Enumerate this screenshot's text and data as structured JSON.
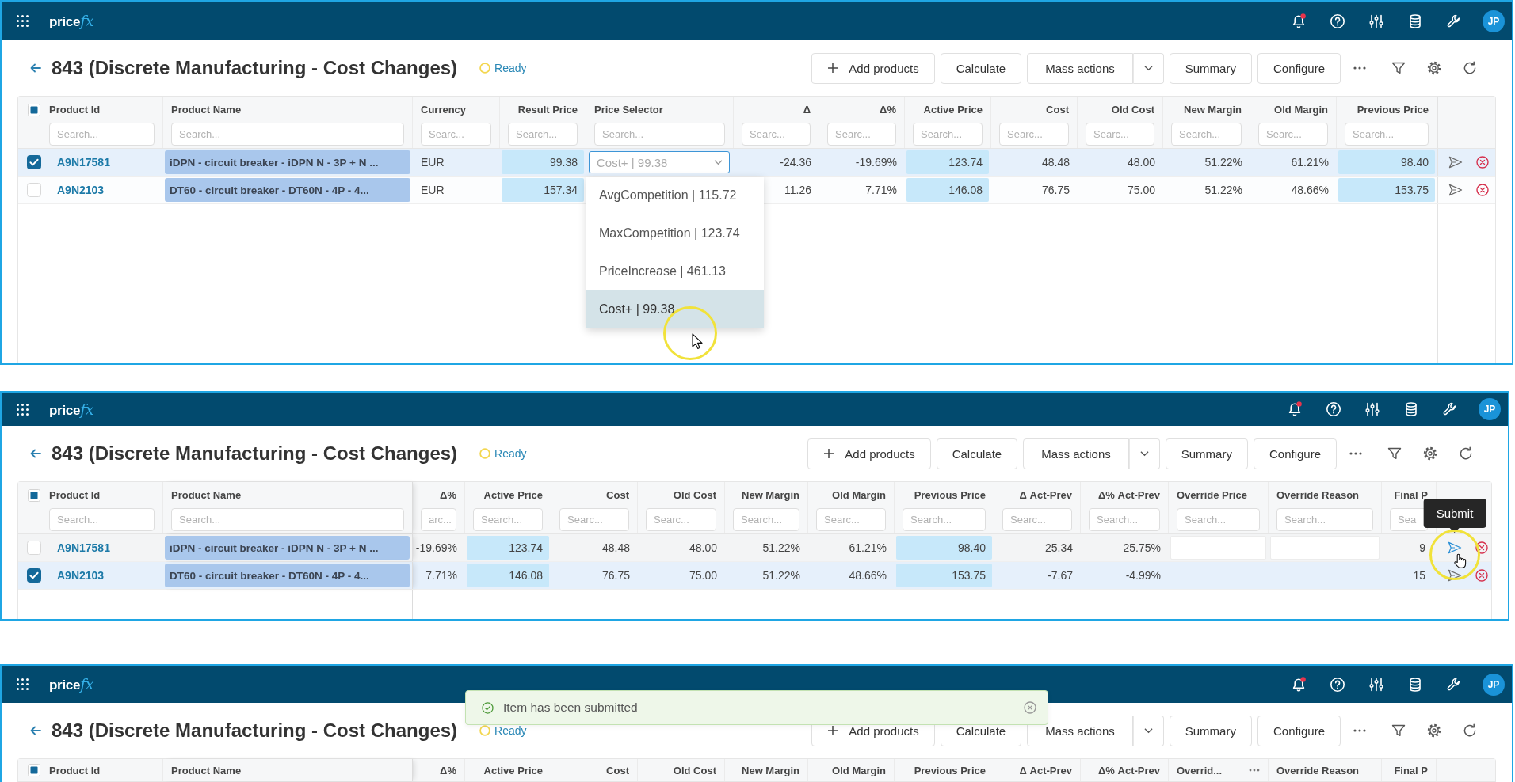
{
  "frames": [
    {
      "app_bar": {
        "logo": "price",
        "logo_accent": "fx",
        "notification": true,
        "avatar": "JP"
      },
      "page": {
        "title": "843 (Discrete Manufacturing - Cost Changes)",
        "status": "Ready"
      },
      "toolbar": {
        "buttons": [
          {
            "label": "Add products",
            "kind": "add"
          },
          {
            "label": "Calculate",
            "kind": "plain"
          },
          {
            "label": "Mass actions",
            "kind": "split"
          },
          {
            "label": "Summary",
            "kind": "plain"
          },
          {
            "label": "Configure",
            "kind": "plain"
          }
        ]
      },
      "table": {
        "header_checkbox": {
          "partial": true
        },
        "columns": [
          {
            "label": "Product Id",
            "placeholder": "Search...",
            "kind": "link"
          },
          {
            "label": "Product Name",
            "placeholder": "Search...",
            "kind": "name"
          },
          {
            "label": "Currency",
            "placeholder": "Searc...",
            "kind": "text"
          },
          {
            "label": "Result Price",
            "placeholder": "Search...",
            "kind": "highlight"
          },
          {
            "label": "Price Selector",
            "placeholder": "Search...",
            "kind": "selector"
          },
          {
            "label": "Δ",
            "placeholder": "Searc...",
            "kind": "number"
          },
          {
            "label": "Δ%",
            "placeholder": "Searc...",
            "kind": "number"
          },
          {
            "label": "Active Price",
            "placeholder": "Search...",
            "kind": "highlight"
          },
          {
            "label": "Cost",
            "placeholder": "Searc...",
            "kind": "number"
          },
          {
            "label": "Old Cost",
            "placeholder": "Searc...",
            "kind": "number"
          },
          {
            "label": "New Margin",
            "placeholder": "Search...",
            "kind": "number"
          },
          {
            "label": "Old Margin",
            "placeholder": "Searc...",
            "kind": "number"
          },
          {
            "label": "Previous Price",
            "placeholder": "Search...",
            "kind": "highlight"
          }
        ],
        "rows": [
          {
            "selected": true,
            "hovered": false,
            "cells": [
              "A9N17581",
              "iDPN - circuit breaker - iDPN N - 3P + N ...",
              "EUR",
              "99.38",
              {
                "placeholder": "Cost+ | 99.38",
                "open": true,
                "options": [
                  {
                    "label": "AvgCompetition | 115.72",
                    "selected": false
                  },
                  {
                    "label": "MaxCompetition | 123.74",
                    "selected": false
                  },
                  {
                    "label": "PriceIncrease | 461.13",
                    "selected": false
                  },
                  {
                    "label": "Cost+ | 99.38",
                    "selected": true
                  }
                ]
              },
              "-24.36",
              "-19.69%",
              "123.74",
              "48.48",
              "48.00",
              "51.22%",
              "61.21%",
              "98.40"
            ]
          },
          {
            "selected": false,
            "hovered": false,
            "cells": [
              "A9N2103",
              "DT60 - circuit breaker - DT60N - 4P - 4...",
              "EUR",
              "157.34",
              null,
              "11.26",
              "7.71%",
              "146.08",
              "76.75",
              "75.00",
              "51.22%",
              "48.66%",
              "153.75"
            ]
          }
        ]
      }
    },
    {
      "app_bar": {
        "logo": "price",
        "logo_accent": "fx",
        "notification": true,
        "avatar": "JP"
      },
      "page": {
        "title": "843 (Discrete Manufacturing - Cost Changes)",
        "status": "Ready"
      },
      "toolbar": {
        "buttons": [
          {
            "label": "Add products",
            "kind": "add"
          },
          {
            "label": "Calculate",
            "kind": "plain"
          },
          {
            "label": "Mass actions",
            "kind": "split"
          },
          {
            "label": "Summary",
            "kind": "plain"
          },
          {
            "label": "Configure",
            "kind": "plain"
          }
        ]
      },
      "table": {
        "header_checkbox": {
          "partial": true
        },
        "scrolled": true,
        "columns": [
          {
            "label": "Product Id",
            "placeholder": "Search...",
            "kind": "link"
          },
          {
            "label": "Product Name",
            "placeholder": "Search...",
            "kind": "name"
          },
          {
            "label": "Δ%",
            "placeholder": "arc...",
            "kind": "number"
          },
          {
            "label": "Active Price",
            "placeholder": "Search...",
            "kind": "highlight"
          },
          {
            "label": "Cost",
            "placeholder": "Searc...",
            "kind": "number"
          },
          {
            "label": "Old Cost",
            "placeholder": "Searc...",
            "kind": "number"
          },
          {
            "label": "New Margin",
            "placeholder": "Search...",
            "kind": "number"
          },
          {
            "label": "Old Margin",
            "placeholder": "Searc...",
            "kind": "number"
          },
          {
            "label": "Previous Price",
            "placeholder": "Search...",
            "kind": "highlight"
          },
          {
            "label": "Δ Act-Prev",
            "placeholder": "Searc...",
            "kind": "number"
          },
          {
            "label": "Δ% Act-Prev",
            "placeholder": "Search...",
            "kind": "number"
          },
          {
            "label": "Override Price",
            "placeholder": "Search...",
            "kind": "input"
          },
          {
            "label": "Override Reason",
            "placeholder": "Search...",
            "kind": "input"
          },
          {
            "label": "Final P",
            "placeholder": "Sea",
            "kind": "number"
          }
        ],
        "rows": [
          {
            "selected": false,
            "hovered": true,
            "tooltip": "Submit",
            "cells": [
              "A9N17581",
              "iDPN - circuit breaker - iDPN N - 3P + N ...",
              "-19.69%",
              "123.74",
              "48.48",
              "48.00",
              "51.22%",
              "61.21%",
              "98.40",
              "25.34",
              "25.75%",
              {
                "editable": true
              },
              {
                "editable": true
              },
              "9"
            ]
          },
          {
            "selected": true,
            "hovered": false,
            "cells": [
              "A9N2103",
              "DT60 - circuit breaker - DT60N - 4P - 4...",
              "7.71%",
              "146.08",
              "76.75",
              "75.00",
              "51.22%",
              "48.66%",
              "153.75",
              "-7.67",
              "-4.99%",
              null,
              null,
              "15"
            ]
          }
        ]
      }
    },
    {
      "app_bar": {
        "logo": "price",
        "logo_accent": "fx",
        "notification": true,
        "avatar": "JP"
      },
      "page": {
        "title": "843 (Discrete Manufacturing - Cost Changes)",
        "status": "Ready"
      },
      "toolbar": {
        "buttons": [
          {
            "label": "Add products",
            "kind": "add"
          },
          {
            "label": "Calculate",
            "kind": "plain"
          },
          {
            "label": "Mass actions",
            "kind": "split"
          },
          {
            "label": "Summary",
            "kind": "plain"
          },
          {
            "label": "Configure",
            "kind": "plain"
          }
        ]
      },
      "toast": {
        "text": "Item has been submitted",
        "kind": "success"
      },
      "table": {
        "header_checkbox": {
          "partial": true
        },
        "scrolled": true,
        "columns": [
          {
            "label": "Product Id",
            "kind": "link"
          },
          {
            "label": "Product Name",
            "kind": "name"
          },
          {
            "label": "Δ%",
            "kind": "number"
          },
          {
            "label": "Active Price",
            "kind": "highlight"
          },
          {
            "label": "Cost",
            "kind": "number"
          },
          {
            "label": "Old Cost",
            "kind": "number"
          },
          {
            "label": "New Margin",
            "kind": "number"
          },
          {
            "label": "Old Margin",
            "kind": "number"
          },
          {
            "label": "Previous Price",
            "kind": "highlight"
          },
          {
            "label": "Δ Act-Prev",
            "kind": "number"
          },
          {
            "label": "Δ% Act-Prev",
            "kind": "number"
          },
          {
            "label": "Overrid...",
            "kind": "input",
            "menu": true
          },
          {
            "label": "Override Reason",
            "kind": "input"
          },
          {
            "label": "Final P",
            "kind": "number"
          }
        ]
      }
    }
  ]
}
